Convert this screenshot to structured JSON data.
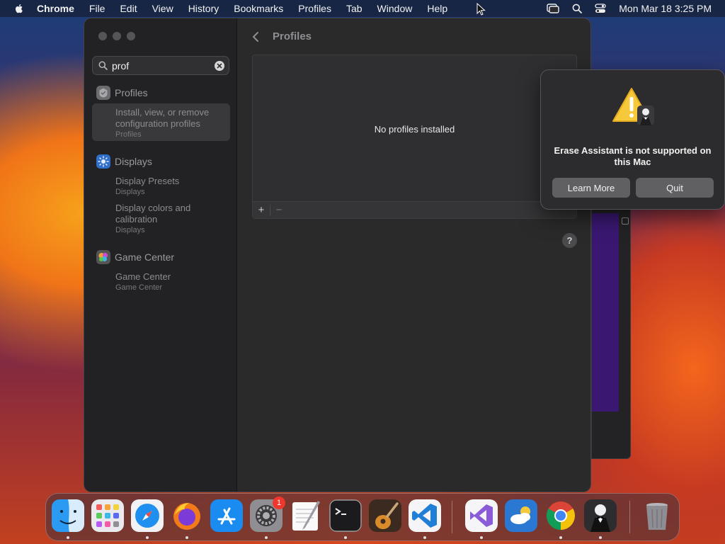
{
  "menubar": {
    "items": [
      "Chrome",
      "File",
      "Edit",
      "View",
      "History",
      "Bookmarks",
      "Profiles",
      "Tab",
      "Window",
      "Help"
    ],
    "clock": "Mon Mar 18  3:25 PM"
  },
  "sidebar": {
    "search_value": "prof",
    "groups": [
      {
        "label": "Profiles",
        "results": [
          {
            "title": "Install, view, or remove configuration profiles",
            "sub": "Profiles"
          }
        ]
      },
      {
        "label": "Displays",
        "results": [
          {
            "title": "Display Presets",
            "sub": "Displays"
          },
          {
            "title": "Display colors and calibration",
            "sub": "Displays"
          }
        ]
      },
      {
        "label": "Game Center",
        "results": [
          {
            "title": "Game Center",
            "sub": "Game Center"
          }
        ]
      }
    ]
  },
  "content": {
    "title": "Profiles",
    "empty_text": "No profiles installed",
    "add": "+",
    "remove": "−",
    "help": "?"
  },
  "alert": {
    "message": "Erase Assistant is not supported on this Mac",
    "learn_more": "Learn More",
    "quit": "Quit"
  },
  "dock": {
    "apps": [
      "Finder",
      "Launchpad",
      "Safari",
      "Firefox",
      "App Store",
      "System Settings",
      "TextEdit",
      "Terminal",
      "GarageBand",
      "Visual Studio Code",
      "Visual Studio",
      "Weather",
      "Google Chrome",
      "Bartender",
      "Trash"
    ],
    "settings_badge": "1"
  },
  "colors": {
    "accent": "#0a84ff",
    "badge": "#f0372e"
  }
}
